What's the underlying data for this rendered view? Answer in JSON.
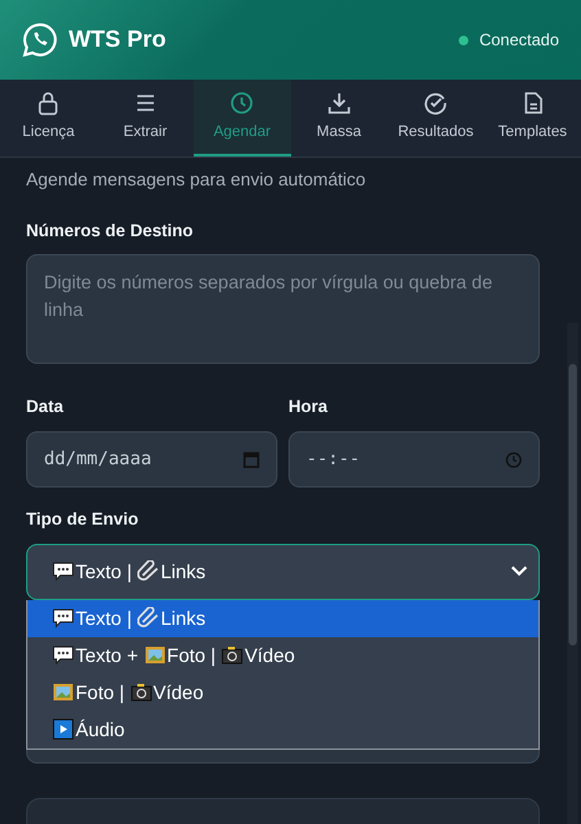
{
  "header": {
    "title": "WTS Pro",
    "status": {
      "label": "Conectado",
      "connected": true
    }
  },
  "tabs": [
    {
      "label": "Licença",
      "kind": "lock",
      "selected": false
    },
    {
      "label": "Extrair",
      "kind": "lines",
      "selected": false
    },
    {
      "label": "Agendar",
      "kind": "clock",
      "selected": true
    },
    {
      "label": "Massa",
      "kind": "download",
      "selected": false
    },
    {
      "label": "Resultados",
      "kind": "check",
      "selected": false
    },
    {
      "label": "Templates",
      "kind": "doc",
      "selected": false
    }
  ],
  "subtitle": "Agende mensagens para envio automático",
  "numbers": {
    "label": "Números de Destino",
    "placeholder": "Digite os números separados por vírgula ou quebra de linha"
  },
  "date": {
    "label": "Data",
    "value": "dd/mm/aaaa"
  },
  "time": {
    "label": "Hora",
    "value": "--:--"
  },
  "send_type": {
    "label": "Tipo de Envio",
    "expanded": true,
    "value": [
      {
        "kind": "chat",
        "text": "Texto |"
      },
      {
        "kind": "link",
        "text": "Links"
      }
    ],
    "options": [
      {
        "selected": true,
        "parts": [
          {
            "kind": "chat",
            "text": "Texto |"
          },
          {
            "kind": "link",
            "text": "Links"
          }
        ]
      },
      {
        "selected": false,
        "parts": [
          {
            "kind": "chat",
            "text": "Texto +"
          },
          {
            "kind": "picture",
            "text": "Foto |"
          },
          {
            "kind": "camera",
            "text": "Vídeo"
          }
        ]
      },
      {
        "selected": false,
        "parts": [
          {
            "kind": "picture",
            "text": "Foto |"
          },
          {
            "kind": "camera",
            "text": "Vídeo"
          }
        ]
      },
      {
        "selected": false,
        "parts": [
          {
            "kind": "play",
            "text": "Áudio"
          }
        ]
      }
    ]
  }
}
